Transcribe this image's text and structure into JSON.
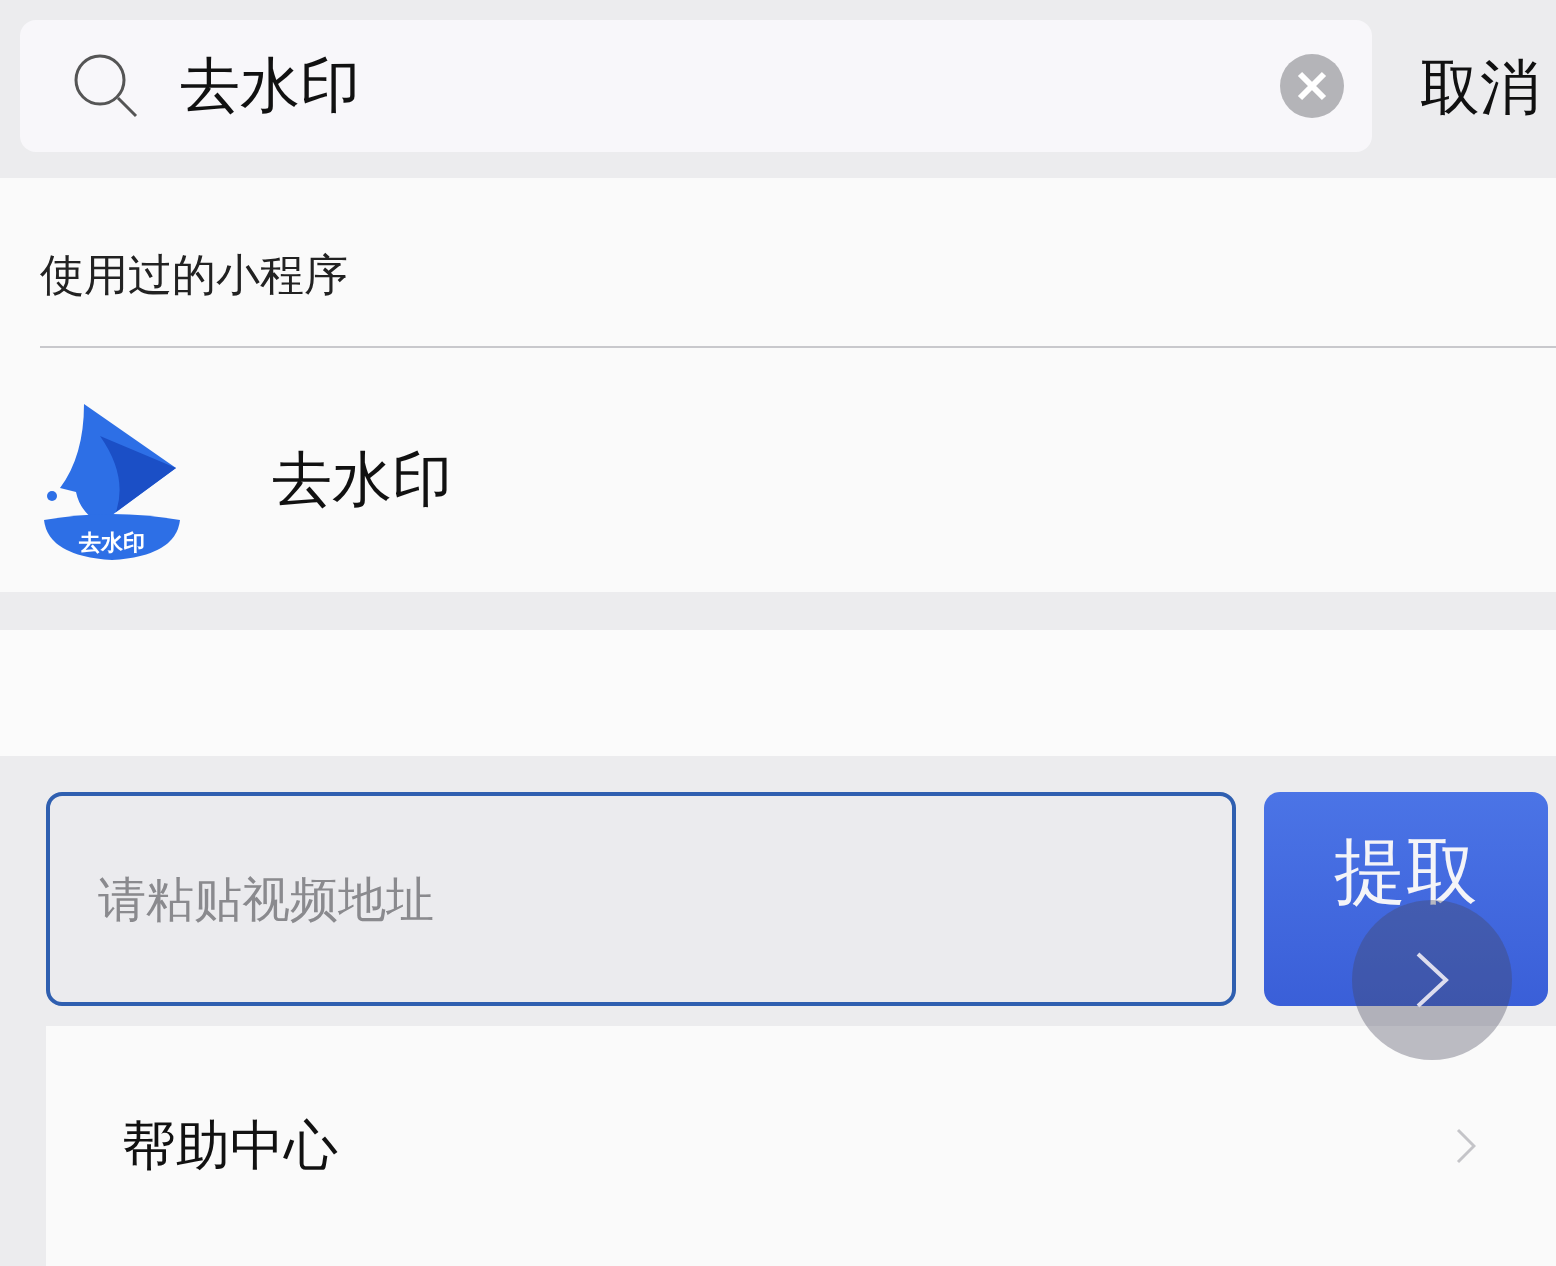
{
  "search": {
    "value": "去水印",
    "cancel": "取消"
  },
  "recent": {
    "title": "使用过的小程序",
    "items": [
      {
        "name": "去水印",
        "logo_text": "去水印"
      }
    ]
  },
  "extract": {
    "placeholder": "请粘贴视频地址",
    "button": "提取"
  },
  "menu": [
    {
      "label": "帮助中心"
    }
  ]
}
